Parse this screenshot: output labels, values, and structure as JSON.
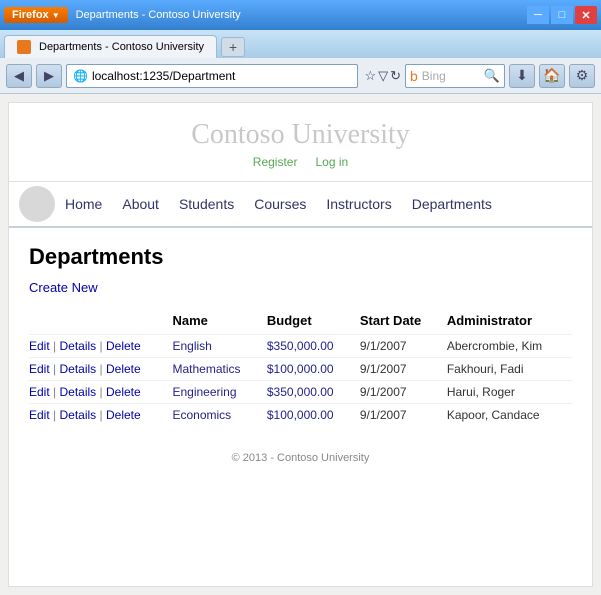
{
  "window": {
    "titlebar": {
      "firefox_label": "Firefox",
      "tab_title": "Departments - Contoso University",
      "new_tab_label": "+"
    },
    "address": "localhost:1235/Department",
    "search_placeholder": "Bing"
  },
  "nav": {
    "register": "Register",
    "login": "Log in",
    "items": [
      {
        "label": "Home",
        "href": "#"
      },
      {
        "label": "About",
        "href": "#"
      },
      {
        "label": "Students",
        "href": "#"
      },
      {
        "label": "Courses",
        "href": "#"
      },
      {
        "label": "Instructors",
        "href": "#"
      },
      {
        "label": "Departments",
        "href": "#"
      }
    ]
  },
  "page": {
    "university_name": "Contoso University",
    "heading": "Departments",
    "create_link": "Create New",
    "table": {
      "headers": [
        "Name",
        "Budget",
        "Start Date",
        "Administrator"
      ],
      "rows": [
        {
          "name": "English",
          "budget": "$350,000.00",
          "start_date": "9/1/2007",
          "administrator": "Abercrombie, Kim"
        },
        {
          "name": "Mathematics",
          "budget": "$100,000.00",
          "start_date": "9/1/2007",
          "administrator": "Fakhouri, Fadi"
        },
        {
          "name": "Engineering",
          "budget": "$350,000.00",
          "start_date": "9/1/2007",
          "administrator": "Harui, Roger"
        },
        {
          "name": "Economics",
          "budget": "$100,000.00",
          "start_date": "9/1/2007",
          "administrator": "Kapoor, Candace"
        }
      ],
      "action_edit": "Edit",
      "action_details": "Details",
      "action_delete": "Delete"
    },
    "footer": "© 2013 - Contoso University"
  }
}
